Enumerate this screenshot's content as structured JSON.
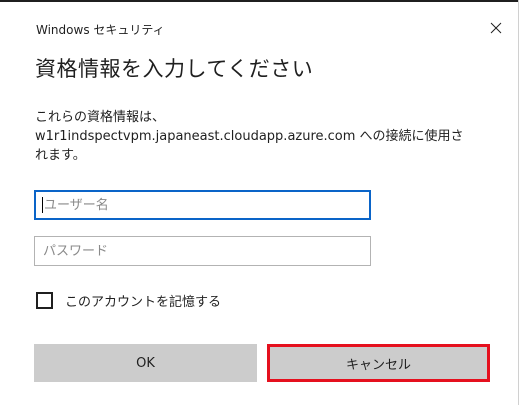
{
  "window": {
    "title": "Windows セキュリティ",
    "close_icon": "close-icon"
  },
  "heading": "資格情報を入力してください",
  "message": {
    "line1": "これらの資格情報は、",
    "line2": "w1r1indspectvpm.japaneast.cloudapp.azure.com への接続に使用さ",
    "line3": "れます。"
  },
  "username": {
    "value": "",
    "placeholder": "ユーザー名"
  },
  "password": {
    "value": "",
    "placeholder": "パスワード"
  },
  "remember": {
    "label": "このアカウントを記憶する",
    "checked": false
  },
  "buttons": {
    "ok_label": "OK",
    "cancel_label": "キャンセル"
  },
  "colors": {
    "focus_border": "#0a64c8",
    "highlight_border": "#e5101e",
    "button_bg": "#cccccc"
  }
}
